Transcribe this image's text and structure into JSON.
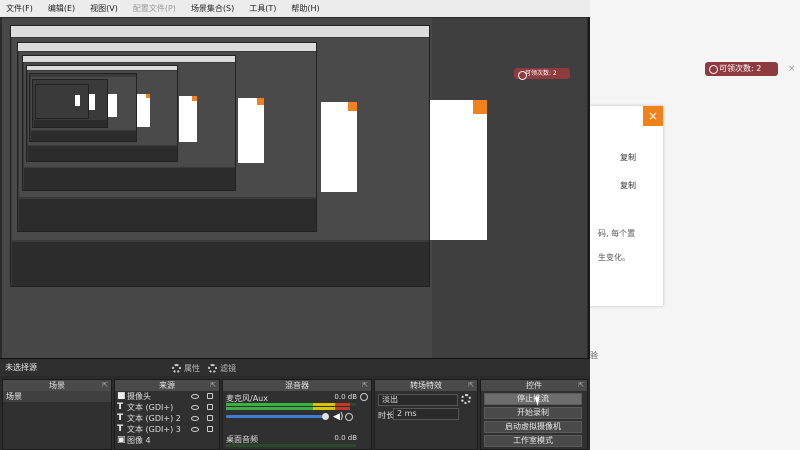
{
  "menu": {
    "items": [
      "文件(F)",
      "编辑(E)",
      "视图(V)",
      "配置文件(P)",
      "场景集合(S)",
      "工具(T)",
      "帮助(H)"
    ],
    "disabled_index": 3
  },
  "background_page": {
    "badge": "可领次数: 2",
    "copy_label": "复制",
    "text_line1": "码, 每个置",
    "text_line2": "生变化。",
    "side_text": "验",
    "close_glyph": "×"
  },
  "source_bar": {
    "label": "未选择源",
    "properties": "属性",
    "filters": "滤镜"
  },
  "panels": {
    "scenes": {
      "title": "场景",
      "items": [
        "场景"
      ]
    },
    "sources": {
      "title": "来源",
      "items": [
        {
          "icon": "camera-icon",
          "label": "摄像头"
        },
        {
          "icon": "text-icon",
          "label": "文本 (GDI+)"
        },
        {
          "icon": "text-icon",
          "label": "文本 (GDI+) 2"
        },
        {
          "icon": "text-icon",
          "label": "文本 (GDI+) 3"
        },
        {
          "icon": "image-icon",
          "label": "图像 4"
        }
      ]
    },
    "mixer": {
      "title": "混音器",
      "channels": [
        {
          "name": "麦克风/Aux",
          "db": "0.0 dB",
          "level": 0.95
        },
        {
          "name": "桌面音频",
          "db": "0.0 dB",
          "level": 0.0
        }
      ]
    },
    "transitions": {
      "title": "转场特效",
      "selected": "淡出",
      "duration_label": "时长",
      "duration_value": "2 ms"
    },
    "controls": {
      "title": "控件",
      "buttons": [
        "停止推流",
        "开始录制",
        "启动虚拟摄像机",
        "工作室模式"
      ],
      "active_index": 0
    }
  },
  "colors": {
    "accent_orange": "#f0821e",
    "badge_red": "#8e3b3f",
    "slider_blue": "#3d7fd0",
    "meter_green": "#3cb043"
  }
}
